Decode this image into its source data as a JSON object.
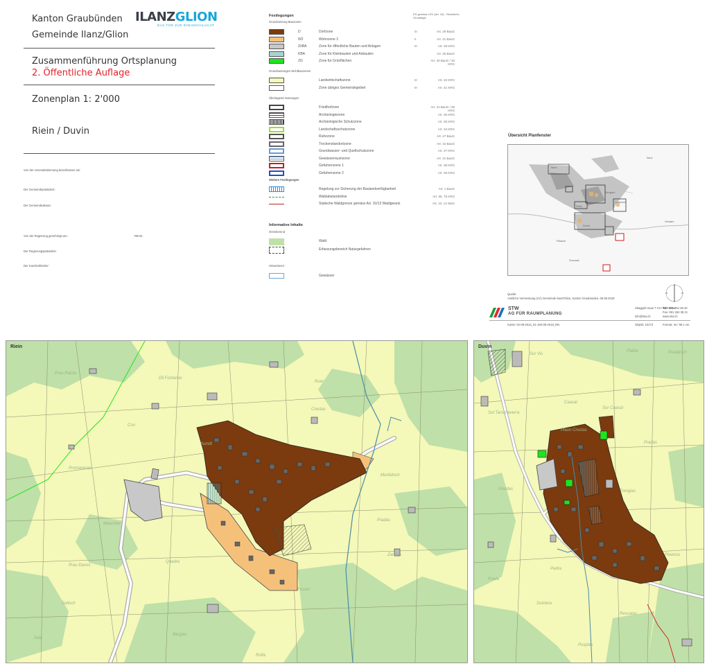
{
  "header": {
    "canton": "Kanton Graubünden",
    "municipality": "Gemeinde Ilanz/Glion",
    "plan_title": "Zusammenführung Ortsplanung",
    "plan_subtitle": "2. Öffentliche Auflage",
    "zone_plan": "Zonenplan 1: 2'000",
    "localities": "Riein / Duvin"
  },
  "logo": {
    "word_ilanz": "ILANZ",
    "word_glion": "GLION",
    "tagline": "DAS TOR ZUR RHEINSCHLUCHT"
  },
  "approvals": {
    "voted": "Von der Urnenabstimmung beschlossen am:",
    "president": "Der Gemeindepräsident:",
    "clerk": "Der Gemeindeaktuar:",
    "approved": "Von der Regierung genehmigt am:",
    "rb": "RB-Nr.",
    "gov_president": "Der Regierungspräsident:",
    "chancellor": "Der Kanzleidirektor:"
  },
  "legend": {
    "festlegungen": "Festlegungen",
    "col_es": "ES gemäss LSV (Art. 43)",
    "col_rg": "Rechtliche Grundlage",
    "bauzonen": "Grundnutzung Bauzonen",
    "bauzonen_items": [
      {
        "code": "D",
        "name": "Dorfzone",
        "es": "III",
        "rg": "Art. 29 BauG",
        "color": "#7b3b0f"
      },
      {
        "code": "W2",
        "name": "Wohnzone 2",
        "es": "II",
        "rg": "Art. 31 BauG",
        "color": "#f5c17a"
      },
      {
        "code": "ZöBA",
        "name": "Zone für öffentliche Bauten und Anlagen",
        "es": "III",
        "rg": "Art. 28 KRG",
        "color": "#c8c8c8"
      },
      {
        "code": "KBA",
        "name": "Zone für Kleinbauten und Anbauten",
        "es": "",
        "rg": "Art. 35 BauG",
        "color": "#a8d4cf"
      },
      {
        "code": "ZG",
        "name": "Zone für Grünflächen",
        "es": "",
        "rg": "Art. 40 BauG / 30 KRG",
        "color": "#1ee41e"
      }
    ],
    "nichtbauzonen": "Grundnutzungen Nichtbauzonen",
    "nichtbauzonen_items": [
      {
        "name": "Landwirtschaftszone",
        "es": "III",
        "rg": "Art. 32 KRG",
        "color": "#f4f8b8"
      },
      {
        "name": "Zone übriges Gemeindegebiet",
        "es": "III",
        "rg": "Art. 41 KRG",
        "color": "#ffffff"
      }
    ],
    "ueberlagert": "Überlagerte Nutzungen",
    "ueberlagert_items": [
      {
        "name": "Friedhofzone",
        "rg": "Art. 41 BauG / 35 KRG"
      },
      {
        "name": "Archäologiezone",
        "rg": "Art. 36 KRG"
      },
      {
        "name": "Archäologische Schutzzone",
        "rg": "Art. 36 KRG"
      },
      {
        "name": "Landschaftsschutzzone",
        "rg": "Art. 34 KRG"
      },
      {
        "name": "Ruhezone",
        "rg": "Art. 47 BauG"
      },
      {
        "name": "Trockenstandortzone",
        "rg": "Art. 42 BauG"
      },
      {
        "name": "Grundwasser- und Quellschutzzone",
        "rg": "Art. 37 KRG"
      },
      {
        "name": "Gewässerraumzone",
        "rg": "Art. 41 BauG"
      },
      {
        "name": "Gefahrenzone 1",
        "rg": "Art. 38 KRG"
      },
      {
        "name": "Gefahrenzone 2",
        "rg": "Art. 38 KRG"
      }
    ],
    "weitere": "Weitere Festlegungen",
    "weitere_items": [
      {
        "name": "Regelung zur Sicherung der Baulandverfügbarkeit",
        "rg": "Art. 1 BauG"
      },
      {
        "name": "Waldabstandslinie",
        "rg": "Art. 55, 75 KRG"
      },
      {
        "name": "Statische Waldgrenze gemäss Art. 10/13 Waldgesetz",
        "rg": "Art. 10, 13 WaG"
      }
    ],
    "informativ": "Informative Inhalte",
    "orientierend": "Orientierend",
    "orient_items": [
      {
        "name": "Wald"
      },
      {
        "name": "Erfassungsbereich Naturgefahren"
      }
    ],
    "hinweisend": "Hinweisend",
    "hinweis_items": [
      {
        "name": "Gewässer"
      }
    ]
  },
  "overview": {
    "title": "Übersicht Planfenster",
    "labels": [
      "Ilanz",
      "Castrisch",
      "Riein",
      "Duvin",
      "Sevgein",
      "Pitasch",
      "Surcasti",
      "Ilanz",
      "Versam"
    ]
  },
  "source": {
    "label": "Quelle:",
    "text": "Amtliche Vermessung (AV) Gemeinde Ilanz/Glion, Kanton Graubünden, 06.08.2018"
  },
  "firm": {
    "name_1": "STW",
    "name_2": "AG FÜR RAUMPLANUNG",
    "address": "Skaggiel Haus 7  CH-7000 Chur",
    "tel": "Tel.: 081 254 38 20",
    "fax": "Fax: 081 254 38 21",
    "email": "info@stw.ch",
    "web": "www.stw.ch",
    "file": "Kartei: 02-08-2014_01-193-08-2018_RN",
    "project": "Objekt: 10173",
    "format": "Format: 44 / 95 x cm"
  },
  "maps": {
    "riein": {
      "title": "Riein",
      "places": [
        "Prau Pazza",
        "Dil Fontanas",
        "Con",
        "Promaneras",
        "Ruel",
        "Crestas",
        "Sumitt",
        "Muntatsch",
        "Mauchtet",
        "Pradas",
        "Prau Davos",
        "Quadra",
        "Saltsch",
        "Fusser",
        "Bargias",
        "Sala",
        "Rolfa",
        "Zanella"
      ]
    },
    "duvin": {
      "title": "Duvin",
      "places": [
        "Sur Vis",
        "Pradatsch",
        "Plattia",
        "Caasal",
        "Sut Tarscheverra",
        "Sur Caasut",
        "Plaun Crestas",
        "Pradas",
        "Gondas",
        "Trengias",
        "Plaunca",
        "Prada",
        "Pedra",
        "Sutclera",
        "Rescatas",
        "Pusplas"
      ]
    }
  }
}
